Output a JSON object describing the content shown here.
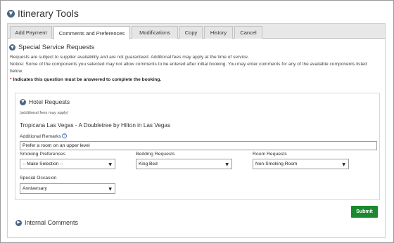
{
  "window": {
    "title": "Itinerary Tools"
  },
  "tabs": [
    {
      "label": "Add Payment"
    },
    {
      "label": "Comments and Preferences"
    },
    {
      "label": "Modifications"
    },
    {
      "label": "Copy"
    },
    {
      "label": "History"
    },
    {
      "label": "Cancel"
    }
  ],
  "active_tab": "Comments and Preferences",
  "section": {
    "title": "Special Service Requests",
    "note1": "Requests are subject to supplier availability and are not guaranteed. Additional fees may apply at the time of service.",
    "note2": "Notice: Some of the components you selected may not allow comments to be entered after initial booking. You may enter comments for any of the available components listed below.",
    "required_star": "*",
    "required_text": "Indicates this question must be answered to complete the booking."
  },
  "hotel": {
    "title": "Hotel Requests",
    "subtitle": "(additional fees may apply)",
    "name": "Tropicana Las Vegas - A Doubletree by Hilton in Las Vegas",
    "remarks_label": "Additional Remarks",
    "help_icon": "?",
    "remarks_value": "Prefer a room on an upper level",
    "smoking_label": "Smoking Preferences",
    "smoking_value": "-- Make Selection --",
    "bedding_label": "Bedding Requests",
    "bedding_value": "King Bed",
    "room_label": "Room Requests",
    "room_value": "Non-Smoking Room",
    "occasion_label": "Special Occasion",
    "occasion_value": "Anniversary"
  },
  "actions": {
    "submit_label": "Submit"
  },
  "internal": {
    "title": "Internal Comments"
  },
  "icons": {
    "chevron_down": "chevron-down-icon",
    "chevron_right": "chevron-right-icon",
    "dropdown_arrow": "▼"
  },
  "colors": {
    "accent_icon": "#4a6585",
    "submit_green": "#198a2e",
    "required_red": "#c0392b"
  }
}
